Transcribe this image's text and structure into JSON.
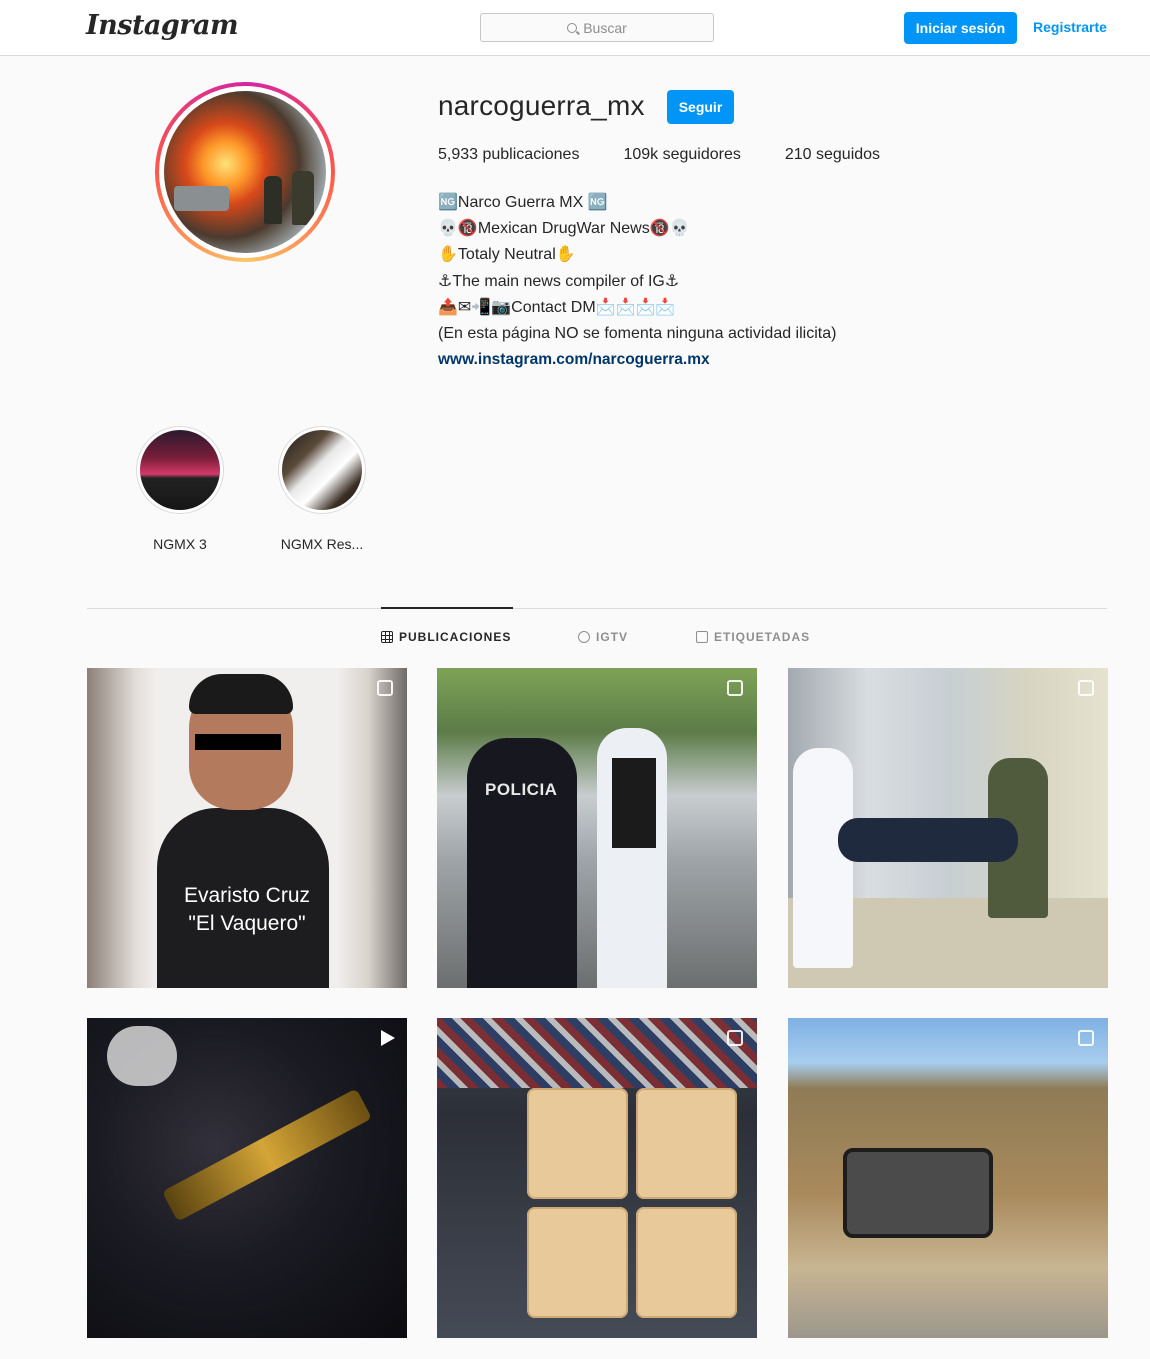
{
  "header": {
    "logo": "Instagram",
    "search_placeholder": "Buscar",
    "login_label": "Iniciar sesión",
    "signup_label": "Registrarte",
    "accent_color": "#0095f6"
  },
  "profile": {
    "username": "narcoguerra_mx",
    "follow_label": "Seguir",
    "stats": {
      "posts": "5,933 publicaciones",
      "followers": "109k seguidores",
      "following": "210 seguidos"
    },
    "bio": [
      "🆖Narco Guerra MX 🆖",
      "💀🔞Mexican DrugWar News🔞💀",
      "✋Totaly Neutral✋",
      "⚓The main news compiler of IG⚓",
      "📤✉📲📷Contact DM📩📩📩📩",
      "(En esta página NO se fomenta ninguna actividad ilicita)"
    ],
    "link": "www.instagram.com/narcoguerra.mx"
  },
  "highlights": [
    {
      "label": "NGMX 3"
    },
    {
      "label": "NGMX Res..."
    }
  ],
  "tabs": [
    {
      "label": "PUBLICACIONES",
      "icon": "grid-icon",
      "active": true
    },
    {
      "label": "IGTV",
      "icon": "igtv-icon",
      "active": false
    },
    {
      "label": "ETIQUETADAS",
      "icon": "tagged-icon",
      "active": false
    }
  ],
  "posts": [
    {
      "caption_line1": "Evaristo Cruz",
      "caption_line2": "\"El Vaquero\"",
      "badge": "multiple-icon"
    },
    {
      "overlay_text": "POLICIA",
      "badge": "multiple-icon"
    },
    {
      "badge": "multiple-icon"
    },
    {
      "badge": "video-icon"
    },
    {
      "badge": "multiple-icon"
    },
    {
      "badge": "multiple-icon"
    }
  ]
}
